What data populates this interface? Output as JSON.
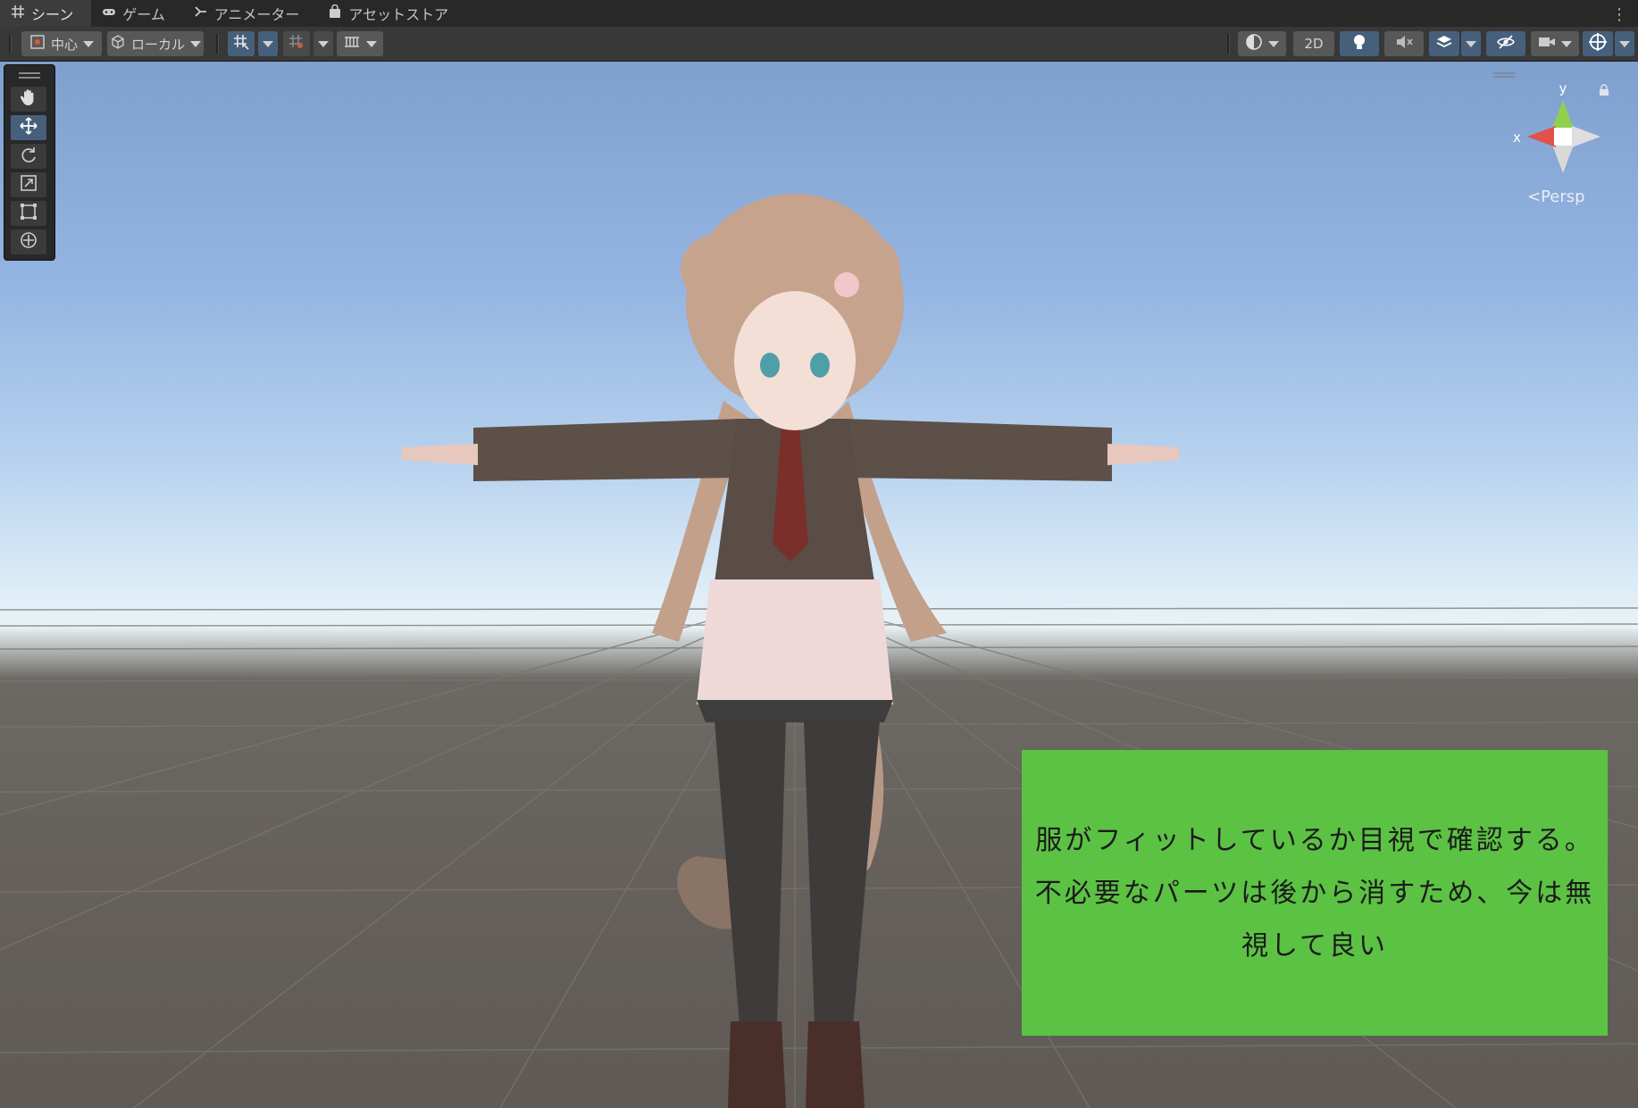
{
  "tabs": [
    {
      "label": "シーン",
      "icon": "grid-icon",
      "active": true
    },
    {
      "label": "ゲーム",
      "icon": "gamepad-icon",
      "active": false
    },
    {
      "label": "アニメーター",
      "icon": "animator-icon",
      "active": false
    },
    {
      "label": "アセットストア",
      "icon": "store-bag-icon",
      "active": false
    }
  ],
  "toolbar": {
    "pivot_label": "中心",
    "space_label": "ローカル",
    "view_2d_label": "2D"
  },
  "gizmo": {
    "y_label": "y",
    "x_label": "x",
    "projection_label": "Persp"
  },
  "overlay": {
    "line1": "服がフィットしているか目視で確認する。",
    "line2": "不必要なパーツは後から消すため、今は無",
    "line3": "視して良い"
  },
  "colors": {
    "overlay_bg": "#5cc244",
    "active_button": "#46607c"
  }
}
